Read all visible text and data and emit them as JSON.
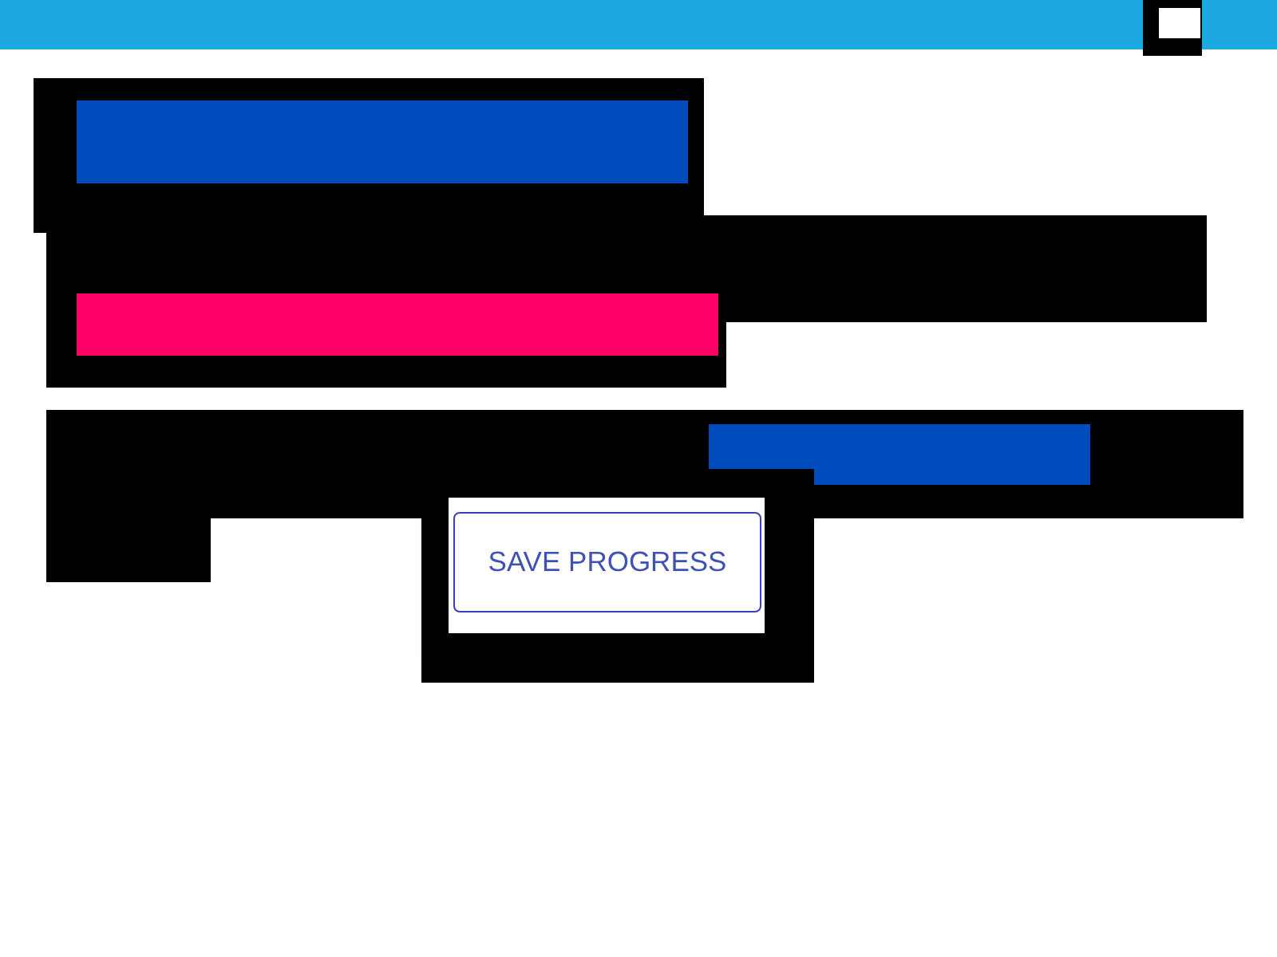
{
  "save_button": {
    "label": "SAVE PROGRESS"
  }
}
